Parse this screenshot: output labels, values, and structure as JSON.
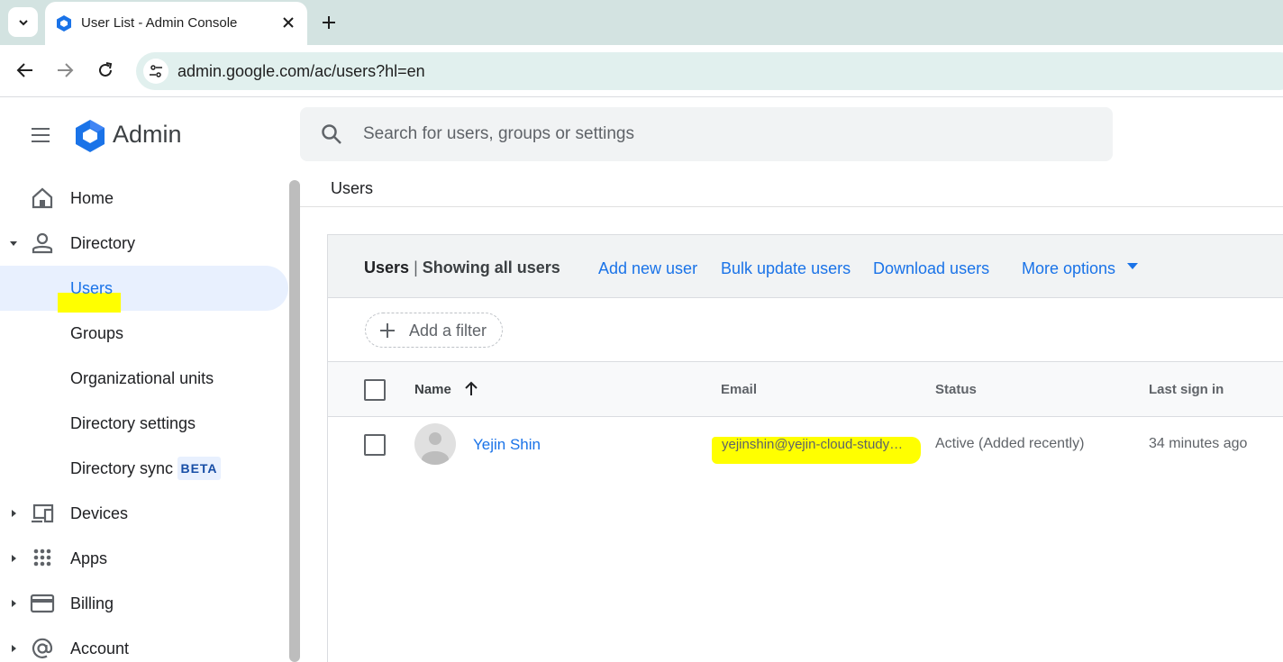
{
  "browser": {
    "tab_title": "User List - Admin Console",
    "url": "admin.google.com/ac/users?hl=en"
  },
  "header": {
    "app_name": "Admin",
    "search_placeholder": "Search for users, groups or settings"
  },
  "sidebar": {
    "items": [
      {
        "label": "Home",
        "icon": "home-icon",
        "expandable": false
      },
      {
        "label": "Directory",
        "icon": "person-icon",
        "expandable": true,
        "expanded": true
      },
      {
        "label": "Users",
        "active": true,
        "highlighted": true
      },
      {
        "label": "Groups"
      },
      {
        "label": "Organizational units"
      },
      {
        "label": "Directory settings"
      },
      {
        "label": "Directory sync",
        "badge": "BETA"
      },
      {
        "label": "Devices",
        "icon": "devices-icon",
        "expandable": true
      },
      {
        "label": "Apps",
        "icon": "apps-grid-icon",
        "expandable": true
      },
      {
        "label": "Billing",
        "icon": "credit-card-icon",
        "expandable": true
      },
      {
        "label": "Account",
        "icon": "at-sign-icon",
        "expandable": true
      }
    ]
  },
  "main": {
    "breadcrumb": "Users",
    "card": {
      "title": "Users",
      "separator": "|",
      "subtitle": "Showing all users",
      "actions": [
        "Add new user",
        "Bulk update users",
        "Download users",
        "More options"
      ],
      "filter_label": "Add a filter"
    },
    "table": {
      "columns": [
        "Name",
        "Email",
        "Status",
        "Last sign in"
      ],
      "rows": [
        {
          "name": "Yejin Shin",
          "email": "yejinshin@yejin-cloud-study…",
          "status": "Active (Added recently)",
          "last_sign_in": "34 minutes ago"
        }
      ]
    }
  },
  "colors": {
    "accent": "#1a73e8",
    "highlight": "#ffff00",
    "active_bg": "#e8f0fe",
    "tabbar_bg": "#d3e3e1"
  }
}
